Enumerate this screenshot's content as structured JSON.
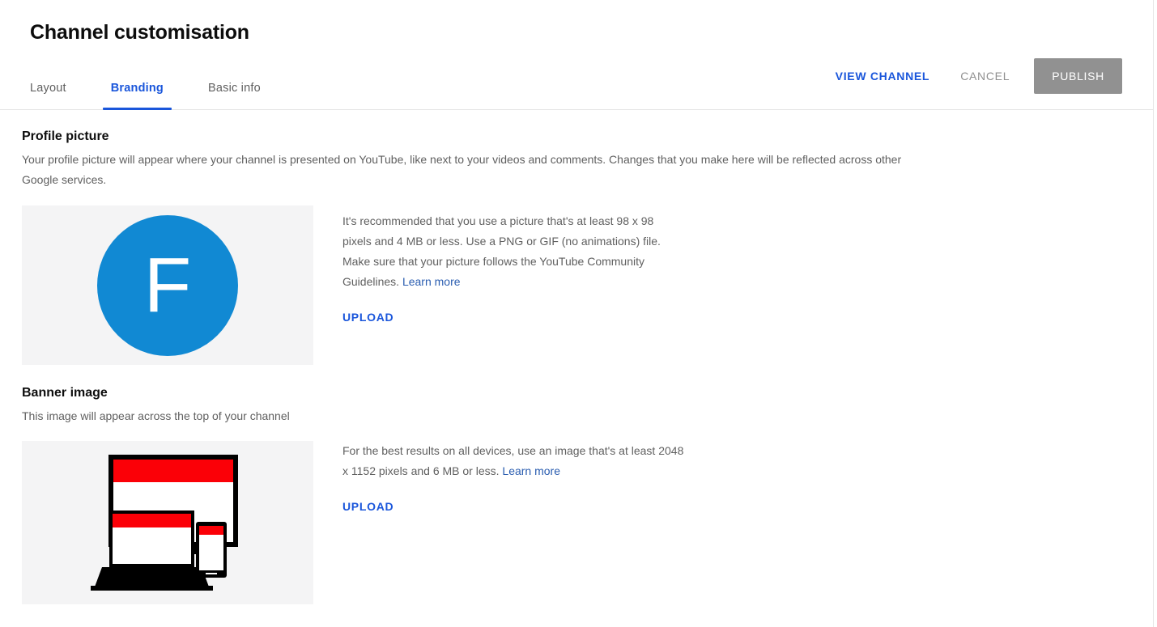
{
  "header": {
    "title": "Channel customisation",
    "tabs": [
      {
        "label": "Layout",
        "active": false
      },
      {
        "label": "Branding",
        "active": true
      },
      {
        "label": "Basic info",
        "active": false
      }
    ],
    "actions": {
      "view_channel": "VIEW CHANNEL",
      "cancel": "CANCEL",
      "publish": "PUBLISH"
    },
    "colors": {
      "active_tab": "#1a56db",
      "link": "#1a56db",
      "publish_bg": "#919191",
      "cancel_text": "#909090"
    }
  },
  "profile_picture": {
    "title": "Profile picture",
    "description": "Your profile picture will appear where your channel is presented on YouTube, like next to your videos and comments. Changes that you make here will be reflected across other Google services.",
    "avatar": {
      "letter": "F",
      "background_color": "#1189d3",
      "text_color": "#ffffff"
    },
    "info_text": "It's recommended that you use a picture that's at least 98 x 98 pixels and 4 MB or less. Use a PNG or GIF (no animations) file. Make sure that your picture follows the YouTube Community Guidelines.",
    "learn_more": "Learn more",
    "upload_label": "UPLOAD"
  },
  "banner_image": {
    "title": "Banner image",
    "description": "This image will appear across the top of your channel",
    "info_text": "For the best results on all devices, use an image that's at least 2048 x 1152 pixels and 6 MB or less.",
    "learn_more": "Learn more",
    "upload_label": "UPLOAD",
    "illustration": {
      "name": "devices-banner-illustration",
      "devices": [
        "monitor",
        "laptop",
        "phone"
      ],
      "banner_color": "#fb0007",
      "frame_color": "#000000",
      "screen_color": "#ffffff"
    }
  },
  "preview_box_color": "#f4f4f5"
}
